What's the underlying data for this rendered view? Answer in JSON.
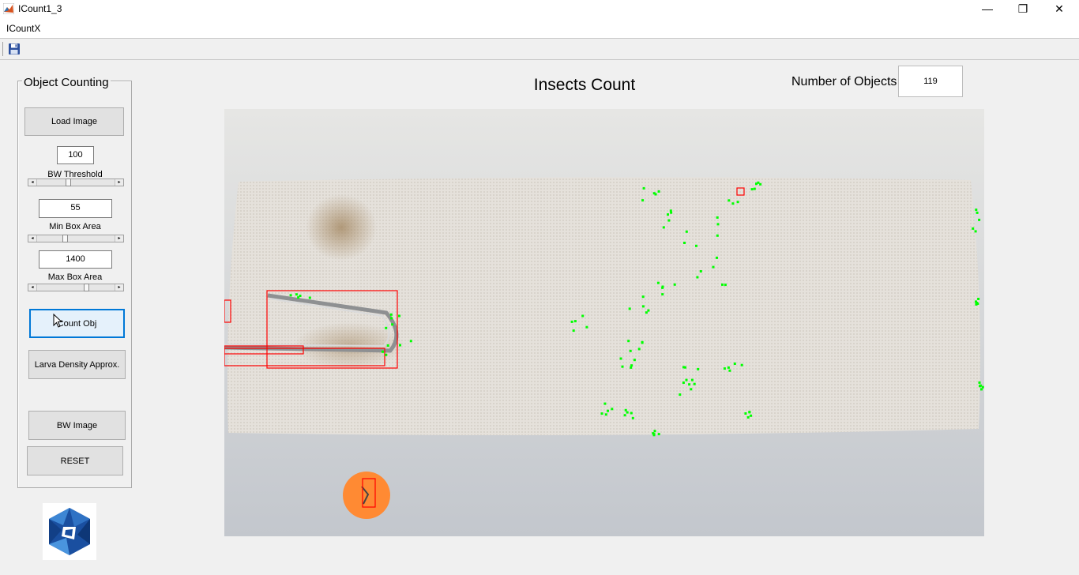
{
  "window": {
    "title": "ICount1_3",
    "controls": [
      "minimize",
      "maximize",
      "close"
    ],
    "minimize_glyph": "—",
    "maximize_glyph": "❐",
    "close_glyph": "✕"
  },
  "menu": {
    "items": [
      "ICountX"
    ]
  },
  "toolbar": {
    "save_icon": "save-icon"
  },
  "panel": {
    "title": "Object Counting",
    "load_image_label": "Load Image",
    "bw_threshold": {
      "value": "100",
      "label": "BW Threshold",
      "slider_fraction": 0.4
    },
    "min_box_area": {
      "value": "55",
      "label": "Min Box Area",
      "slider_fraction": 0.35
    },
    "max_box_area": {
      "value": "1400",
      "label": "Max Box Area",
      "slider_fraction": 0.65
    },
    "count_obj_label": "Count Obj",
    "larva_density_label": "Larva Density Approx.",
    "bw_image_label": "BW Image",
    "reset_label": "RESET"
  },
  "main": {
    "title": "Insects Count",
    "count_label": "Number of Objects",
    "count_value": "119"
  },
  "colors": {
    "detection_box": "#ff0000",
    "detection_marker": "#00ff00",
    "focus_border": "#0078d7"
  }
}
